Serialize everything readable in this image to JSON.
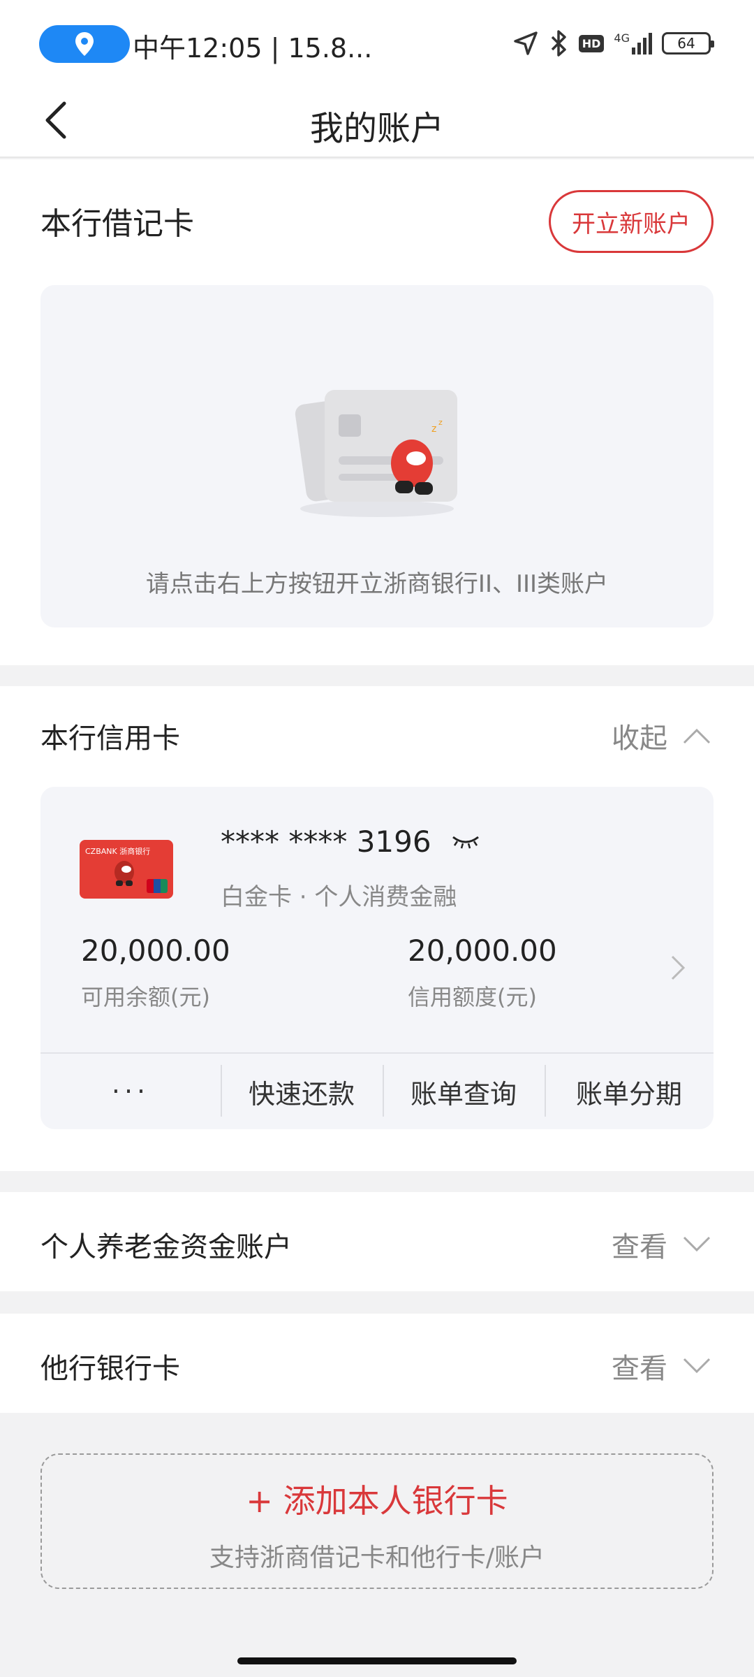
{
  "status_bar": {
    "time_text": "中午12:05 | 15.8...",
    "network": "4G",
    "hd": "HD",
    "battery": "64"
  },
  "nav": {
    "title": "我的账户"
  },
  "debit": {
    "title": "本行借记卡",
    "open_button": "开立新账户",
    "empty_hint": "请点击右上方按钮开立浙商银行II、III类账户"
  },
  "credit": {
    "title": "本行信用卡",
    "toggle": "收起",
    "card": {
      "bank_logo_text": "CZBANK 浙商银行",
      "number": "**** **** 3196",
      "type": "白金卡 · 个人消费金融",
      "available_amount": "20,000.00",
      "available_label": "可用余额(元)",
      "limit_amount": "20,000.00",
      "limit_label": "信用额度(元)"
    },
    "actions": [
      "···",
      "快速还款",
      "账单查询",
      "账单分期"
    ]
  },
  "pension": {
    "title": "个人养老金资金账户",
    "toggle": "查看"
  },
  "other_bank": {
    "title": "他行银行卡",
    "toggle": "查看"
  },
  "add_card": {
    "title": "+ 添加本人银行卡",
    "subtitle": "支持浙商借记卡和他行卡/账户"
  },
  "colors": {
    "accent_red": "#d9383a",
    "location_blue": "#1e88f5",
    "card_bg": "#f4f5f9"
  },
  "icons": [
    "location-icon",
    "navigation-arrow-icon",
    "bluetooth-icon",
    "signal-icon",
    "battery-icon",
    "back-arrow-icon",
    "card-illustration-icon",
    "eye-closed-icon",
    "chevron-up-icon",
    "chevron-right-icon",
    "chevron-down-icon"
  ]
}
